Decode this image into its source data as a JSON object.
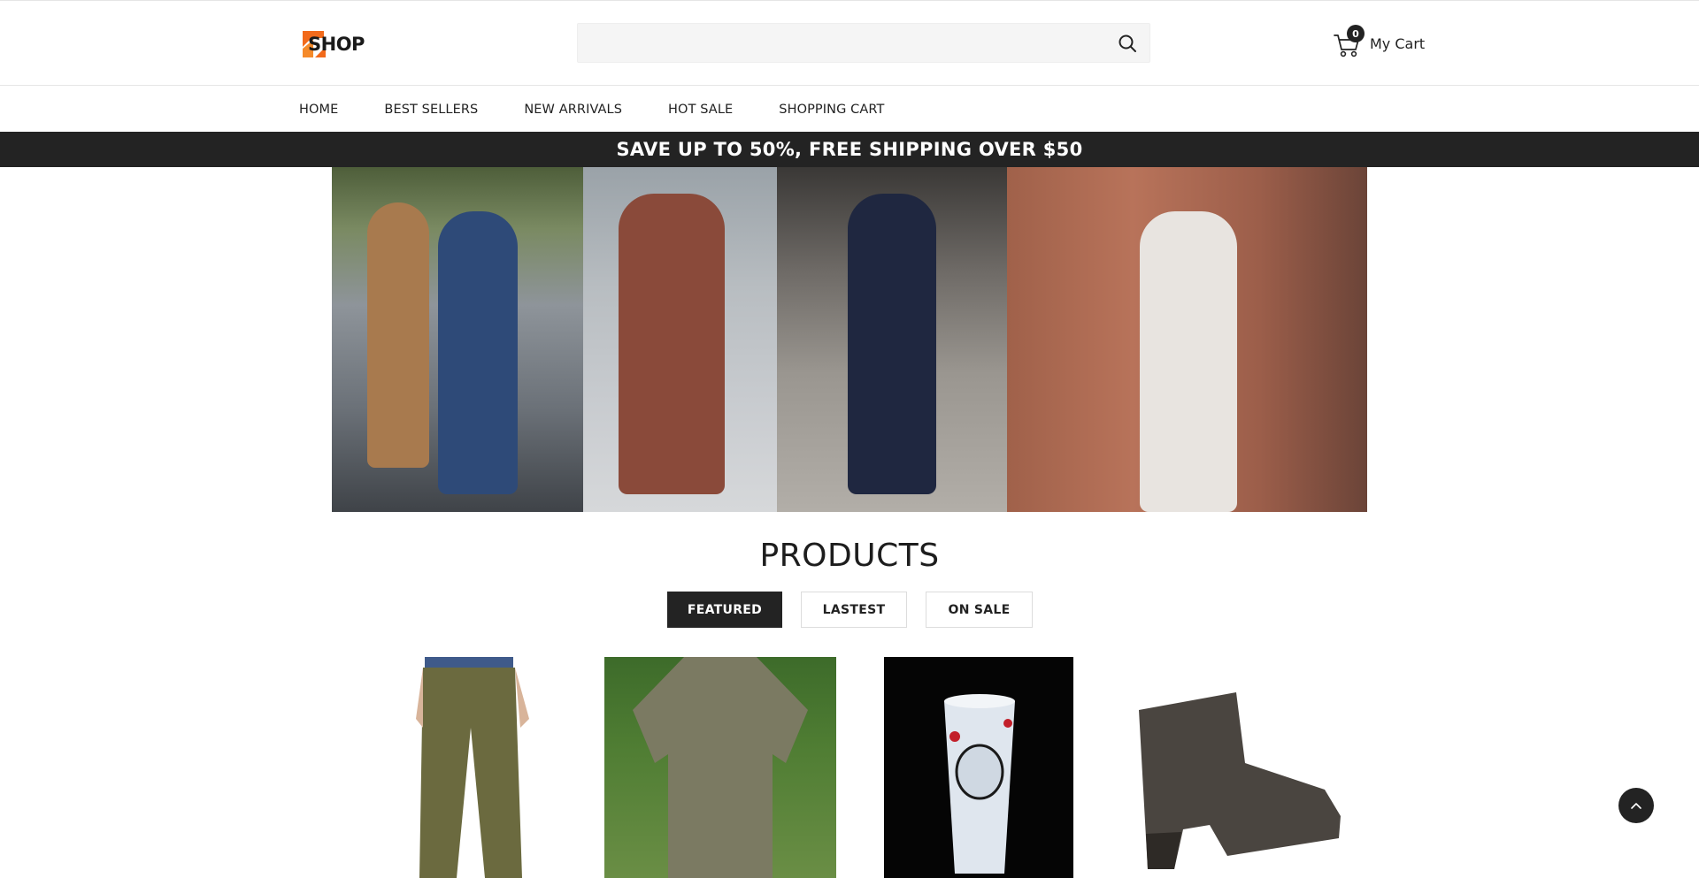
{
  "header": {
    "logo_text": "SHOP",
    "search": {
      "value": "",
      "placeholder": ""
    },
    "cart": {
      "count": "0",
      "label": "My Cart"
    }
  },
  "nav": {
    "items": [
      {
        "label": "HOME"
      },
      {
        "label": "BEST SELLERS"
      },
      {
        "label": "NEW ARRIVALS"
      },
      {
        "label": "HOT SALE"
      },
      {
        "label": "SHOPPING CART"
      }
    ]
  },
  "promo": {
    "text": "SAVE UP TO 50%, FREE SHIPPING OVER $50"
  },
  "products": {
    "title": "PRODUCTS",
    "tabs": [
      {
        "label": "FEATURED",
        "active": true
      },
      {
        "label": "LASTEST",
        "active": false
      },
      {
        "label": "ON SALE",
        "active": false
      }
    ]
  },
  "colors": {
    "accent_dark": "#232323",
    "logo_orange": "#f26a1b",
    "search_bg": "#f5f5f5"
  }
}
